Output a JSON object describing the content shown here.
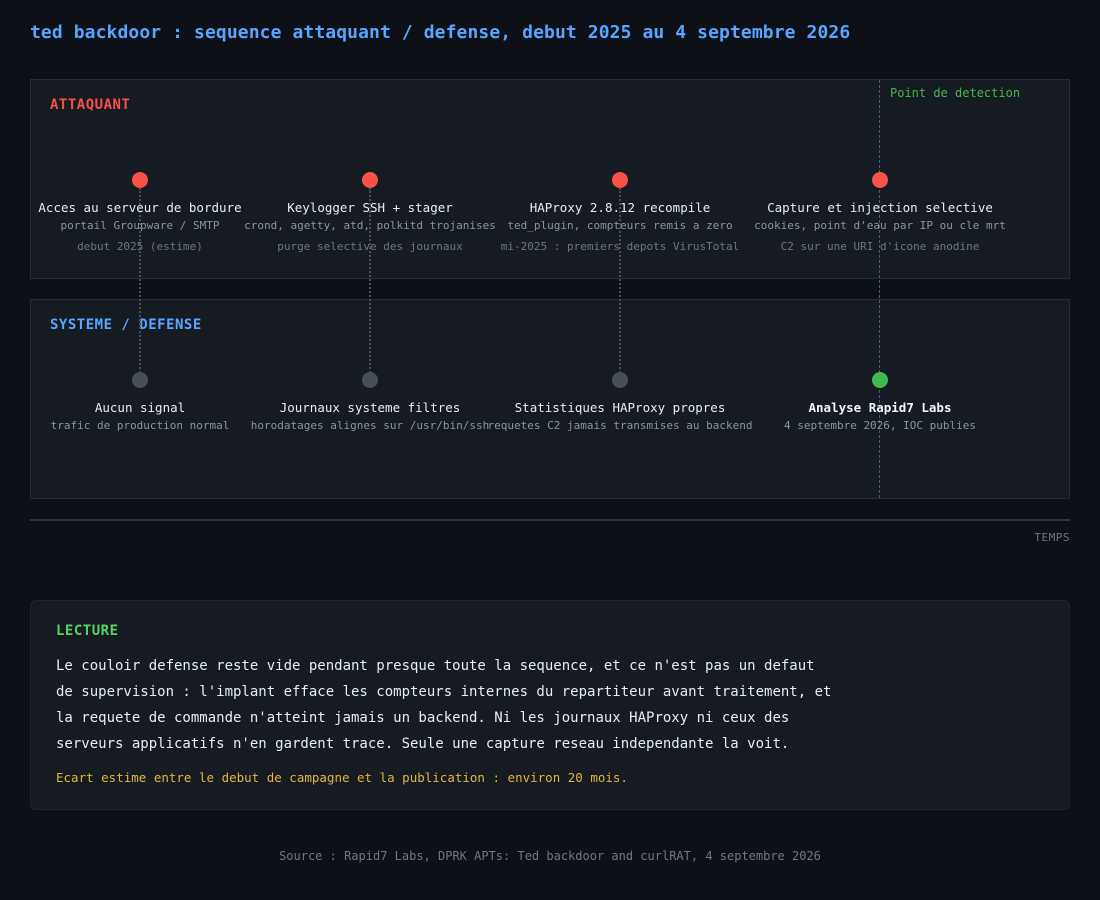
{
  "title": "ted backdoor : sequence attaquant / defense, debut 2025 au 4 septembre 2026",
  "colors": {
    "background": "#0d1117",
    "panel": "#161b22",
    "attacker": "#f85149",
    "defense": "#58a6ff",
    "detection": "#3fb950",
    "neutral_dot": "#484f58",
    "note": "#e3b341"
  },
  "lanes": {
    "attacker": {
      "label": "ATTAQUANT",
      "events": [
        {
          "title": "Acces au serveur de bordure",
          "detail": "portail Groupware / SMTP",
          "date": "debut 2025 (estime)"
        },
        {
          "title": "Keylogger SSH + stager",
          "detail": "crond, agetty, atd, polkitd trojanises",
          "date": "purge selective des journaux"
        },
        {
          "title": "HAProxy 2.8.12 recompile",
          "detail": "ted_plugin, compteurs remis a zero",
          "date": "mi-2025 : premiers depots VirusTotal"
        },
        {
          "title": "Capture et injection selective",
          "detail": "cookies, point d'eau par IP ou cle mrt",
          "date": "C2 sur une URI d'icone anodine"
        }
      ]
    },
    "defense": {
      "label": "SYSTEME / DEFENSE",
      "events": [
        {
          "title": "Aucun signal",
          "detail": "trafic de production normal"
        },
        {
          "title": "Journaux systeme filtres",
          "detail": "horodatages alignes sur /usr/bin/ssh"
        },
        {
          "title": "Statistiques HAProxy propres",
          "detail": "requetes C2 jamais transmises au backend"
        },
        {
          "title": "Analyse Rapid7 Labs",
          "detail": "4 septembre 2026, IOC publies"
        }
      ]
    }
  },
  "detection": {
    "label": "Point de detection"
  },
  "axis": {
    "label": "TEMPS"
  },
  "reading": {
    "label": "LECTURE",
    "lines": [
      "Le couloir defense reste vide pendant presque toute la sequence, et ce n'est pas un defaut",
      "de supervision : l'implant efface les compteurs internes du repartiteur avant traitement, et",
      "la requete de commande n'atteint jamais un backend. Ni les journaux HAProxy ni ceux des",
      "serveurs applicatifs n'en gardent trace. Seule une capture reseau independante la voit."
    ],
    "note": "Ecart estime entre le debut de campagne et la publication : environ 20 mois."
  },
  "source": "Source : Rapid7 Labs, DPRK APTs: Ted backdoor and curlRAT, 4 septembre 2026"
}
